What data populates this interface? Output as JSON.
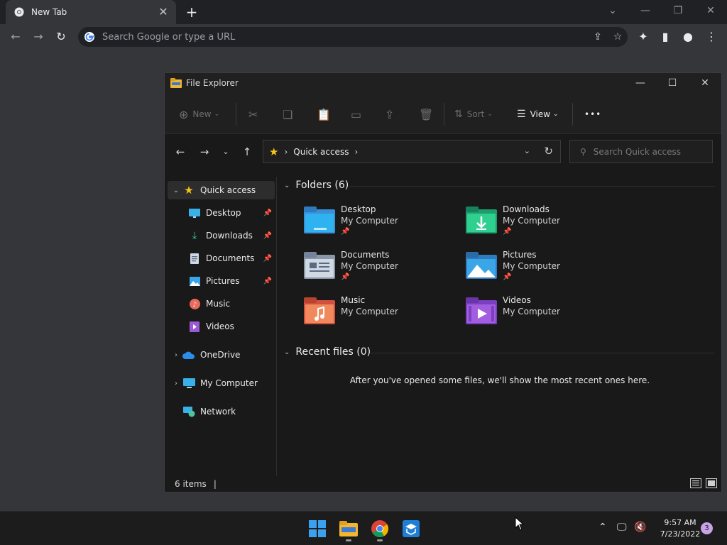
{
  "chrome": {
    "tab_title": "New Tab",
    "tab_close": "✕",
    "new_tab": "+",
    "omnibox_placeholder": "Search Google or type a URL"
  },
  "explorer": {
    "title": "File Explorer",
    "commands": {
      "new": "New",
      "sort": "Sort",
      "view": "View",
      "more": "•••"
    },
    "address": {
      "location": "Quick access"
    },
    "search_placeholder": "Search Quick access",
    "nav": {
      "quick_access": "Quick access",
      "pinned": [
        {
          "label": "Desktop",
          "icon": "desktop-icon"
        },
        {
          "label": "Downloads",
          "icon": "downloads-icon"
        },
        {
          "label": "Documents",
          "icon": "documents-icon"
        },
        {
          "label": "Pictures",
          "icon": "pictures-icon"
        }
      ],
      "music": "Music",
      "videos": "Videos",
      "onedrive": "OneDrive",
      "my_computer": "My Computer",
      "network": "Network"
    },
    "folders_header": "Folders (6)",
    "folders": [
      {
        "name": "Desktop",
        "location": "My Computer",
        "pinned": true
      },
      {
        "name": "Downloads",
        "location": "My Computer",
        "pinned": true
      },
      {
        "name": "Documents",
        "location": "My Computer",
        "pinned": true
      },
      {
        "name": "Pictures",
        "location": "My Computer",
        "pinned": true
      },
      {
        "name": "Music",
        "location": "My Computer",
        "pinned": false
      },
      {
        "name": "Videos",
        "location": "My Computer",
        "pinned": false
      }
    ],
    "recent_header": "Recent files (0)",
    "recent_empty": "After you've opened some files, we'll show the most recent ones here.",
    "status_items": "6 items",
    "status_bar": "|"
  },
  "taskbar": {
    "time": "9:57 AM",
    "date": "7/23/2022",
    "notifications": "3"
  }
}
